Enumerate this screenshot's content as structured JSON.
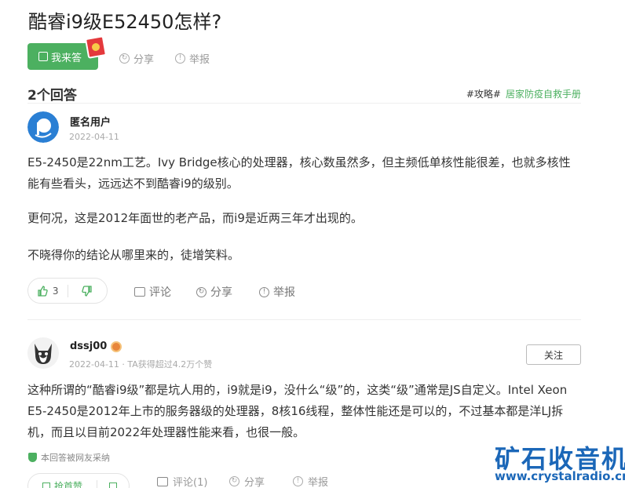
{
  "question": {
    "title": "酷睿i9级E52450怎样?",
    "answer_button": "我来答",
    "share": "分享",
    "report": "举报"
  },
  "answers_header": {
    "count_label": "2个回答",
    "tag": "#攻略#",
    "tag_link": "居家防疫自救手册"
  },
  "answer1": {
    "user": "匿名用户",
    "date": "2022-04-11",
    "paragraphs": [
      "E5-2450是22nm工艺。Ivy Bridge核心的处理器，核心数虽然多，但主频低单核性能很差，也就多核性能有些看头，远远达不到酷睿i9的级别。",
      "更何况，这是2012年面世的老产品，而i9是近两三年才出现的。",
      "不晓得你的结论从哪里来的，徒增笑料。"
    ],
    "likes": "3",
    "comment": "评论",
    "share": "分享",
    "report": "举报"
  },
  "answer2": {
    "user": "dssj00",
    "meta": "2022-04-11 · TA获得超过4.2万个赞",
    "follow": "关注",
    "paragraph": "这种所谓的“酷睿i9级”都是坑人用的，i9就是i9，没什么“级”的，这类“级”通常是JS自定义。Intel Xeon E5-2450是2012年上市的服务器级的处理器，8核16线程，整体性能还是可以的，不过基本都是洋LJ拆机，而且以目前2022年处理器性能来看，也很一般。",
    "adopted": "本回答被网友采纳",
    "first_like": "抢首赞",
    "comment": "评论(1)",
    "share": "分享",
    "report": "举报"
  },
  "watermark": {
    "line1": "矿石收音机",
    "line2": "www.crystalradio.cn"
  },
  "colors": {
    "green": "#4cb060",
    "watermark_blue": "#1b67b8",
    "text": "#333333"
  }
}
